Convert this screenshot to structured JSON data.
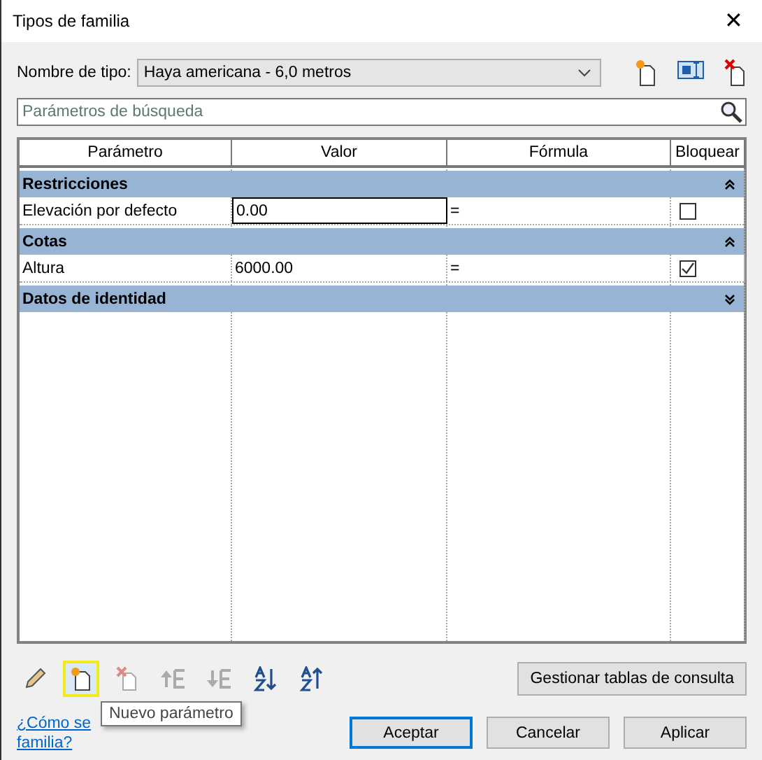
{
  "window": {
    "title": "Tipos de familia",
    "close": "✕"
  },
  "type_name": {
    "label": "Nombre de tipo:",
    "value": "Haya americana - 6,0 metros"
  },
  "search": {
    "placeholder": "Parámetros de búsqueda"
  },
  "table": {
    "columns": [
      "Parámetro",
      "Valor",
      "Fórmula",
      "Bloquear"
    ],
    "groups": [
      {
        "name": "Restricciones",
        "expanded": true,
        "rows": [
          {
            "parameter": "Elevación por defecto",
            "value": "0.00",
            "formula": "=",
            "locked": false,
            "editing": true
          }
        ]
      },
      {
        "name": "Cotas",
        "expanded": true,
        "rows": [
          {
            "parameter": "Altura",
            "value": "6000.00",
            "formula": "=",
            "locked": true,
            "editing": false
          }
        ]
      },
      {
        "name": "Datos de identidad",
        "expanded": false
      }
    ]
  },
  "tools": [
    {
      "kind": "edit",
      "disabled": false,
      "highlighted": false
    },
    {
      "kind": "new",
      "disabled": false,
      "highlighted": true
    },
    {
      "kind": "delete",
      "disabled": true,
      "highlighted": false
    },
    {
      "kind": "up",
      "disabled": true,
      "highlighted": false
    },
    {
      "kind": "down",
      "disabled": true,
      "highlighted": false
    },
    {
      "kind": "sort-asc",
      "disabled": false,
      "highlighted": false
    },
    {
      "kind": "sort-desc",
      "disabled": false,
      "highlighted": false
    }
  ],
  "tooltip": "Nuevo parámetro",
  "lookup_button": "Gestionar tablas de consulta",
  "help_link": [
    "¿Cómo se",
    "familia?"
  ],
  "buttons": [
    {
      "label": "Aceptar",
      "default": true
    },
    {
      "label": "Cancelar",
      "default": false
    },
    {
      "label": "Aplicar",
      "default": false
    }
  ]
}
